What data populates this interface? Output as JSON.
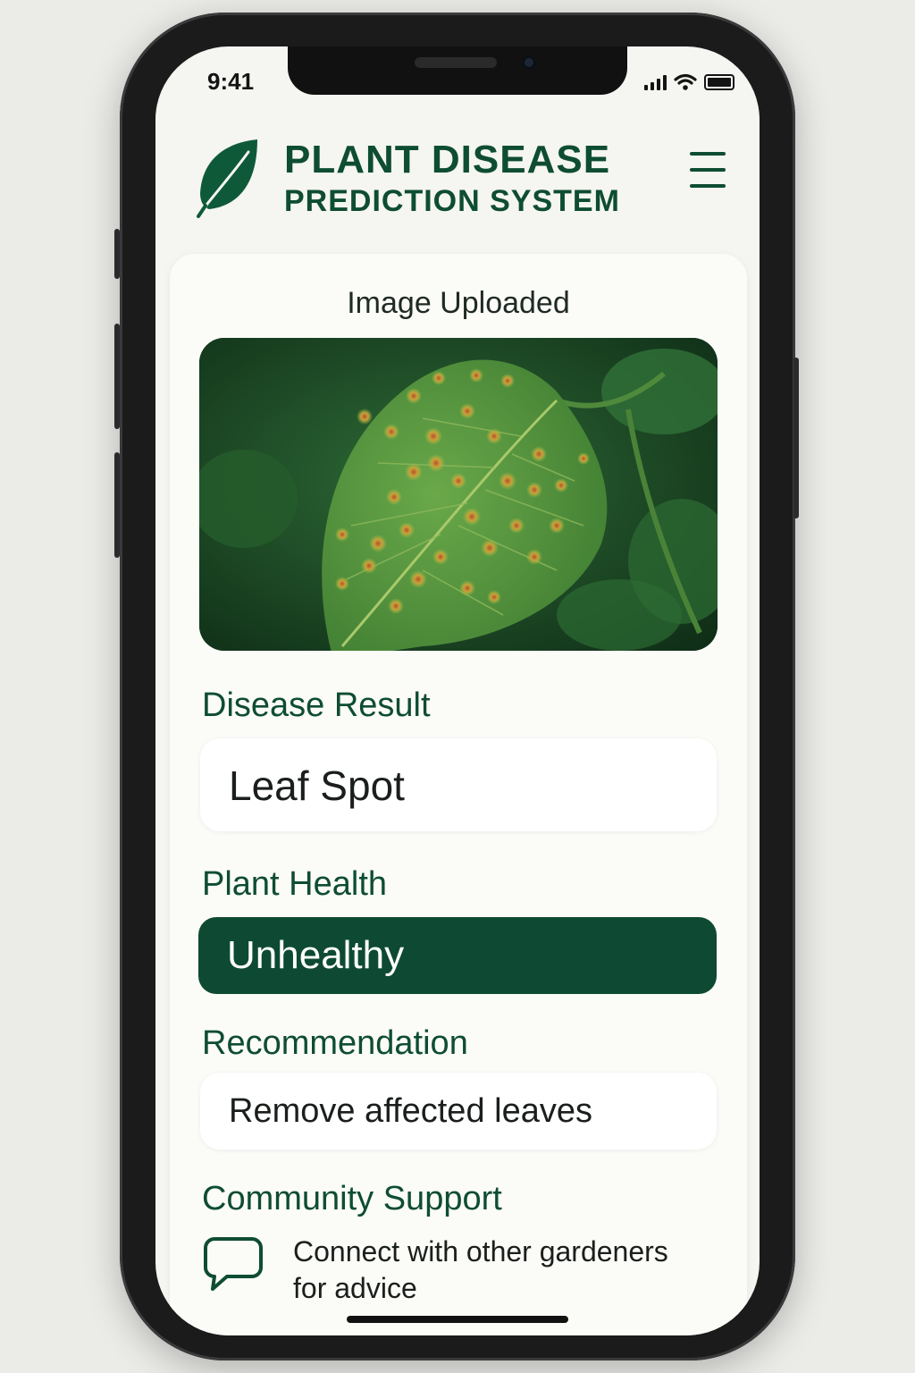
{
  "status_bar": {
    "time": "9:41"
  },
  "header": {
    "title_line1": "PLANT DISEASE",
    "title_line2": "PREDICTION SYSTEM",
    "logo_icon": "leaf-icon",
    "menu_icon": "hamburger-menu-icon"
  },
  "upload": {
    "title": "Image Uploaded"
  },
  "disease": {
    "label": "Disease Result",
    "value": "Leaf Spot"
  },
  "health": {
    "label": "Plant Health",
    "value": "Unhealthy"
  },
  "recommendation": {
    "label": "Recommendation",
    "value": "Remove affected leaves"
  },
  "community": {
    "label": "Community Support",
    "text_line1": "Connect with other gardeners",
    "text_line2": "for advice",
    "icon": "chat-bubble-icon"
  },
  "colors": {
    "brand_green": "#0e4d32",
    "health_badge": "#0e4a33",
    "screen_bg": "#f5f5f1"
  }
}
